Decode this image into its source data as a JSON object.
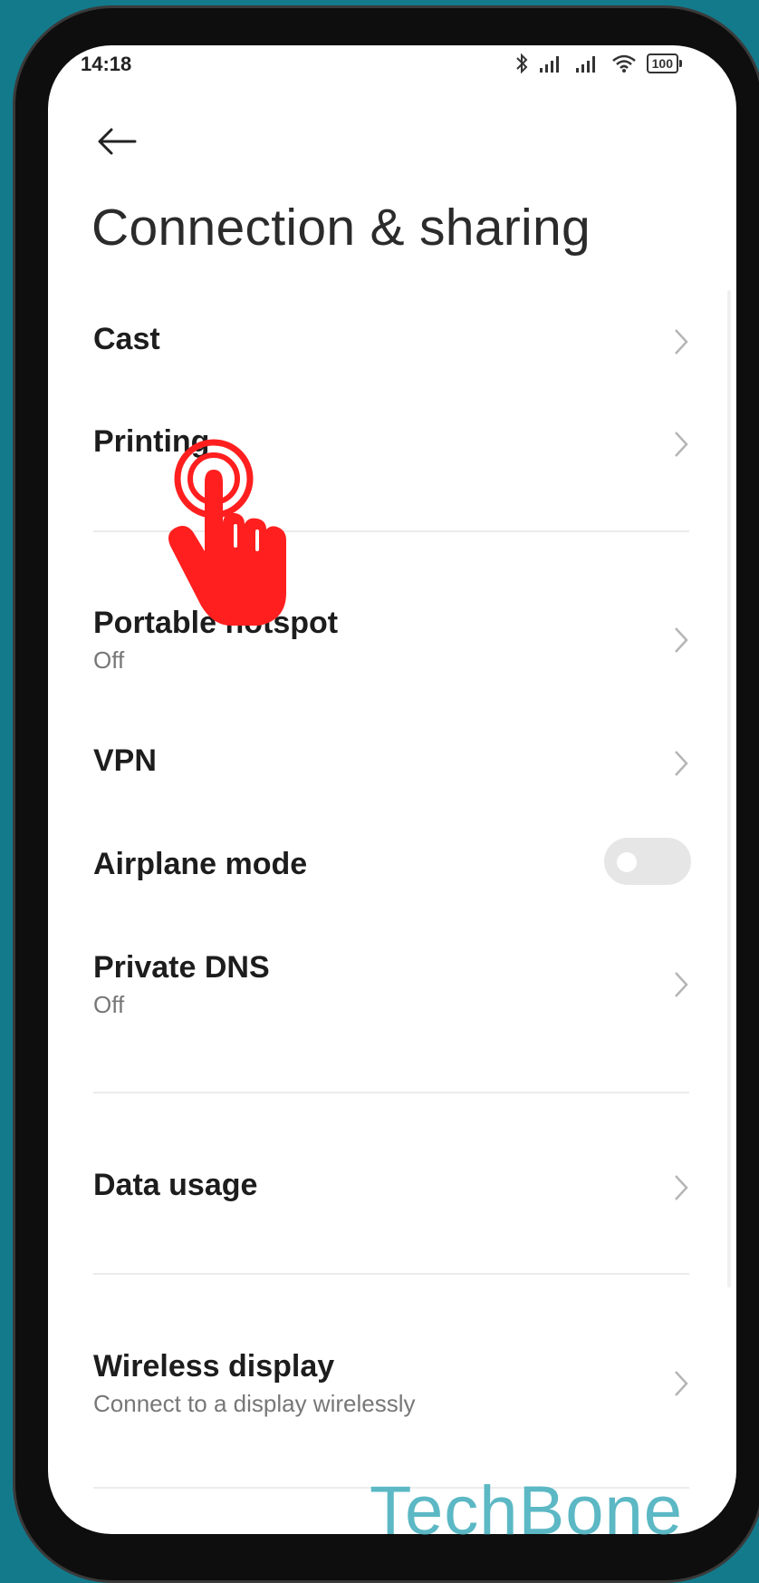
{
  "status_bar": {
    "time": "14:18",
    "battery": "100"
  },
  "page": {
    "title": "Connection & sharing"
  },
  "items": [
    {
      "label": "Cast"
    },
    {
      "label": "Printing"
    },
    {
      "label": "Portable hotspot",
      "sub": "Off"
    },
    {
      "label": "VPN"
    },
    {
      "label": "Airplane mode",
      "toggle": false
    },
    {
      "label": "Private DNS",
      "sub": "Off"
    },
    {
      "label": "Data usage"
    },
    {
      "label": "Wireless display",
      "sub": "Connect to a display wirelessly"
    }
  ],
  "watermark": "TechBone",
  "colors": {
    "background": "#137a8c",
    "tap_indicator": "#ff1f1f",
    "watermark": "#5bb8c4"
  },
  "icons": [
    "back-arrow-icon",
    "bluetooth-icon",
    "signal-icon",
    "wifi-icon",
    "battery-icon",
    "chevron-right-icon",
    "tap-hand-icon"
  ]
}
